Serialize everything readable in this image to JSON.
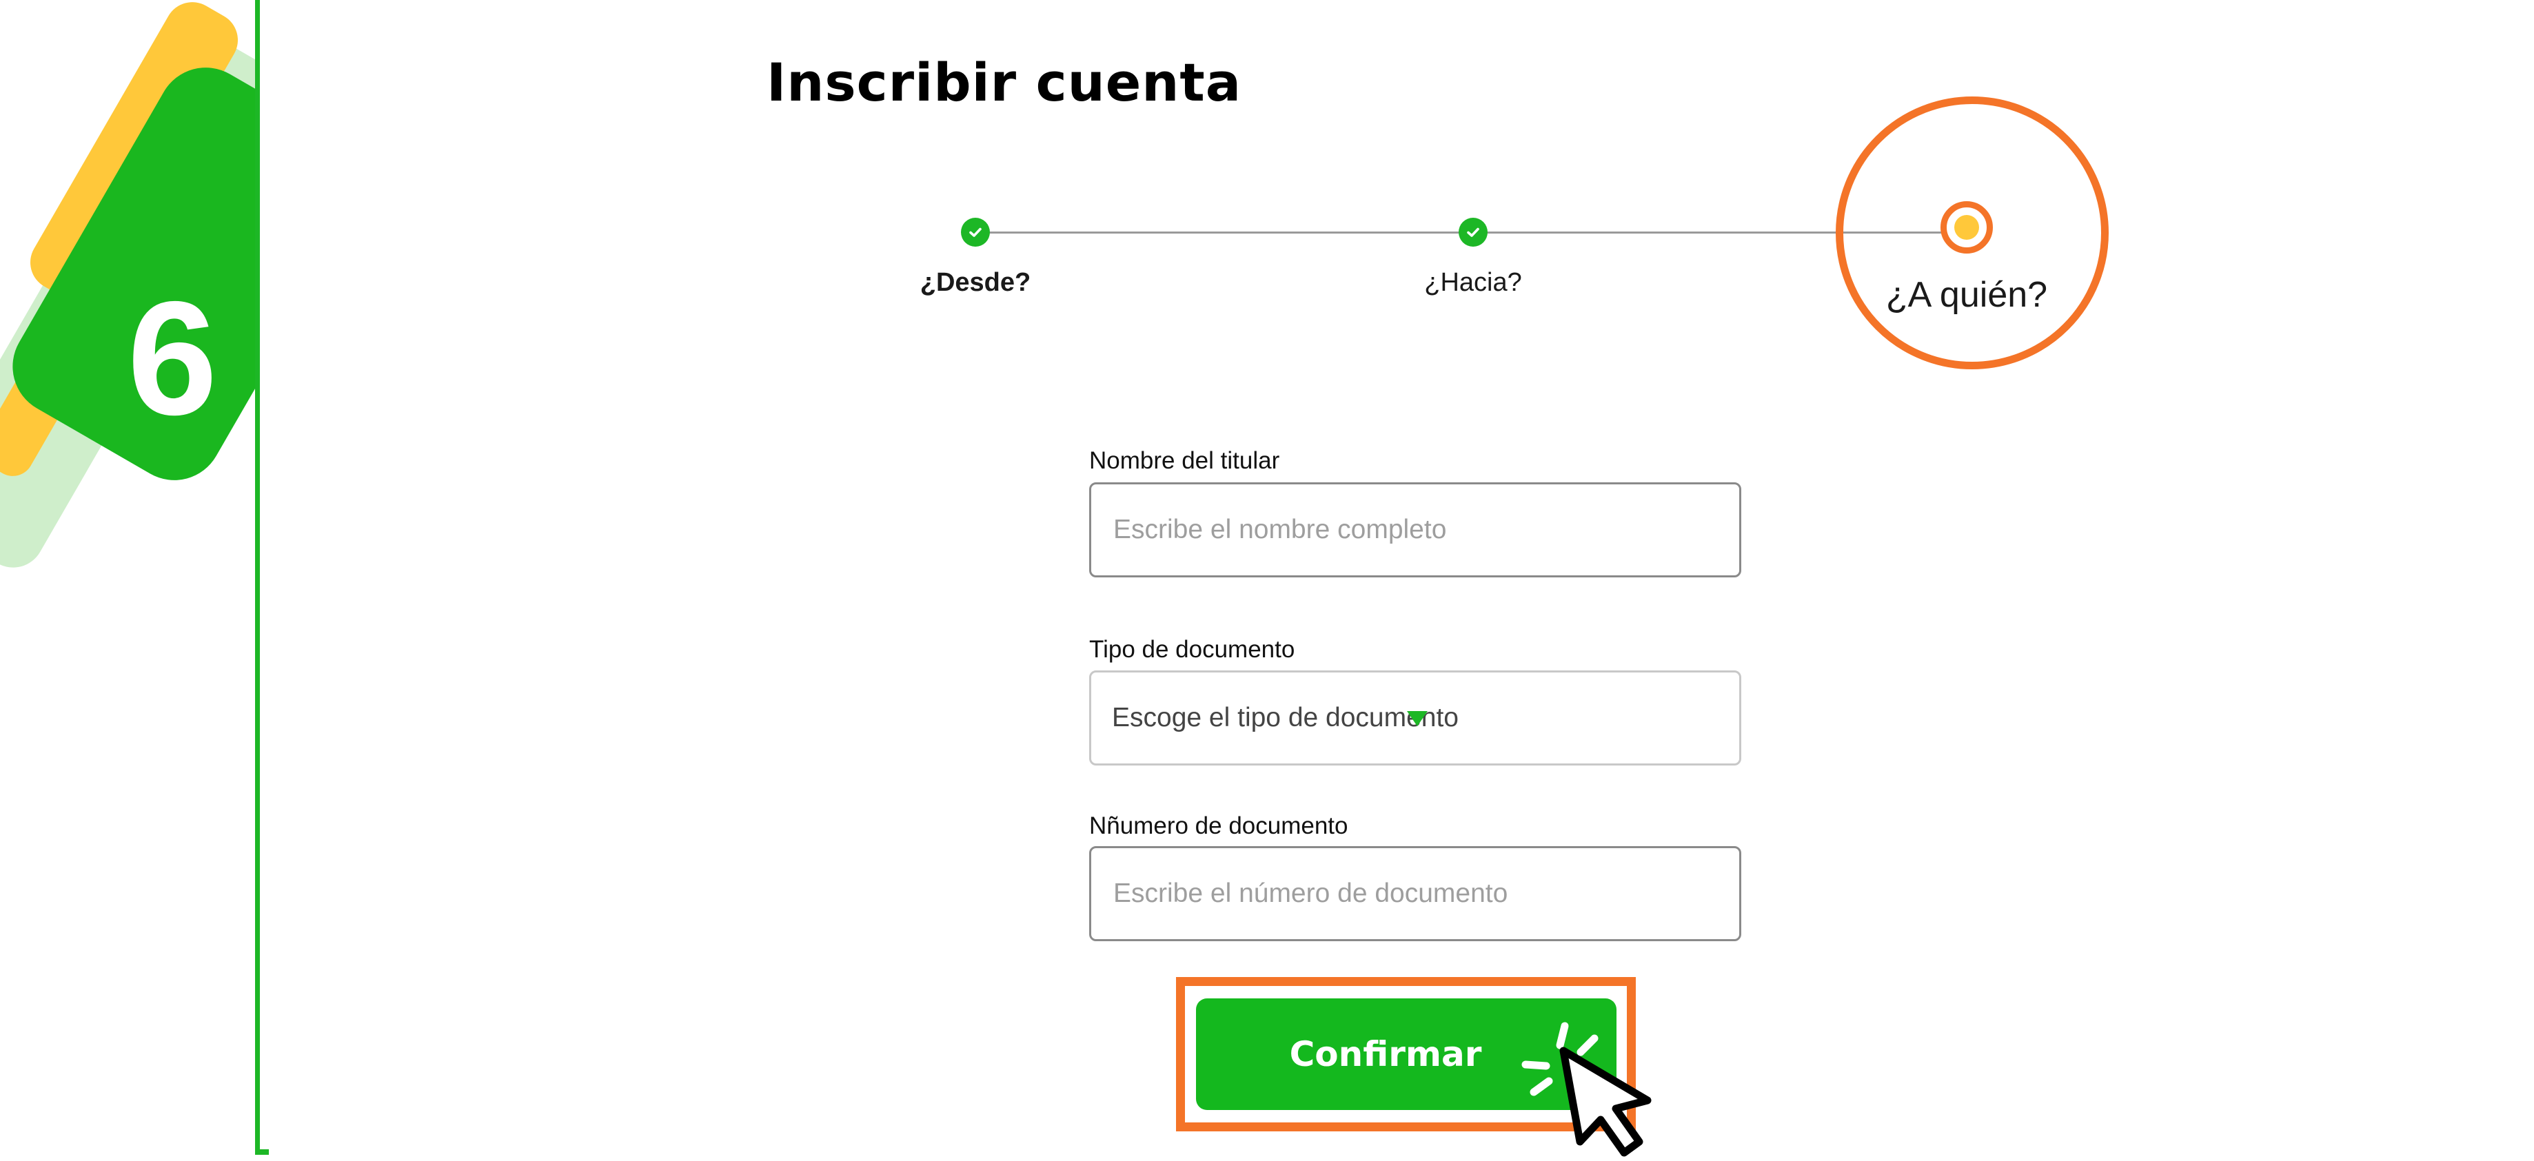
{
  "tutorial": {
    "step_number": "6"
  },
  "page": {
    "title": "Inscribir cuenta"
  },
  "stepper": {
    "steps": [
      {
        "label": "¿Desde?",
        "state": "completed"
      },
      {
        "label": "¿Hacia?",
        "state": "completed"
      },
      {
        "label": "¿A quién?",
        "state": "current"
      }
    ]
  },
  "form": {
    "holder_name": {
      "label": "Nombre del titular",
      "placeholder": "Escribe el nombre completo",
      "value": ""
    },
    "document_type": {
      "label": "Tipo de documento",
      "placeholder": "Escoge el tipo de documento",
      "selected": ""
    },
    "document_number": {
      "label": "Nñumero de documento",
      "placeholder": "Escribe el número de documento",
      "value": ""
    },
    "confirm_label": "Confirmar"
  },
  "colors": {
    "brand_green": "#14b81e",
    "highlight_orange": "#f47428",
    "accent_yellow": "#ffc83a"
  },
  "icons": [
    "checkmark-icon",
    "dropdown-arrow-icon",
    "cursor-pointer-icon",
    "click-burst-icon"
  ]
}
